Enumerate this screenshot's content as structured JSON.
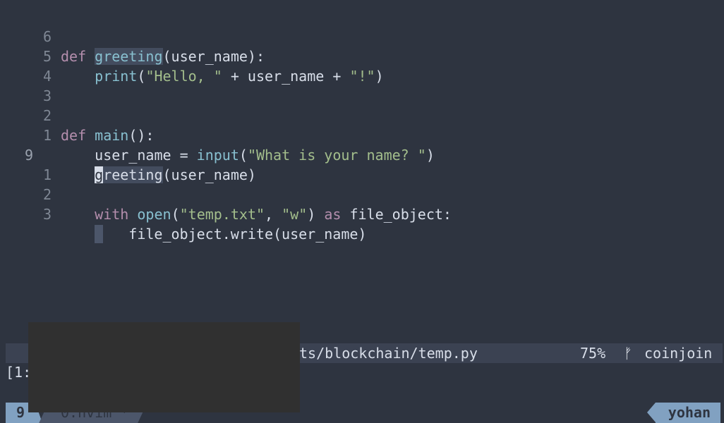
{
  "editor": {
    "lines": [
      {
        "rel": "6",
        "text": "def greeting(user_name):"
      },
      {
        "rel": "5",
        "text": "    print(\"Hello, \" + user_name + \"!\")"
      },
      {
        "rel": "4",
        "text": ""
      },
      {
        "rel": "3",
        "text": ""
      },
      {
        "rel": "2",
        "text": "def main():"
      },
      {
        "rel": "1",
        "text": "    user_name = input(\"What is your name? \")"
      },
      {
        "rel": "9",
        "text": "    greeting(user_name)"
      },
      {
        "rel": "1",
        "text": ""
      },
      {
        "rel": "2",
        "text": "    with open(\"temp.txt\", \"w\") as file_object:"
      },
      {
        "rel": "3",
        "text": "        file_object.write(user_name)"
      }
    ],
    "tokens": {
      "def": "def",
      "greeting": "greeting",
      "params1": "(user_name):",
      "print": "print",
      "print_args_open": "(",
      "hello_str": "\"Hello, \"",
      "concat1": " + user_name + ",
      "bang_str": "\"!\"",
      "close_paren": ")",
      "main": "main",
      "main_sig": "():",
      "user_name_assign": "user_name = ",
      "input": "input",
      "prompt_str": "\"What is your name? \"",
      "greeting_cursor_char": "g",
      "greeting_rest": "reeting",
      "greeting_args": "(user_name)",
      "with": "with",
      "open": "open",
      "temp_str": "\"temp.txt\"",
      "comma": ", ",
      "w_str": "\"w\"",
      "as": "as",
      "file_object": " file_object:",
      "write_call": "file_object.write(user_name)"
    }
  },
  "statusline": {
    "path": "ts/blockchain/temp.py",
    "percent": "75%",
    "branch_icon": "ᚠ",
    "branch": "coinjoin"
  },
  "cmdline": {
    "text": "[1:"
  },
  "tmux": {
    "pane": "9",
    "window": "0:nvim *",
    "host": "yohan"
  },
  "colors": {
    "background": "#2e3440",
    "keyword": "#b48ead",
    "function": "#88c0d0",
    "string": "#a3be8c",
    "accent": "#81a1c1"
  }
}
